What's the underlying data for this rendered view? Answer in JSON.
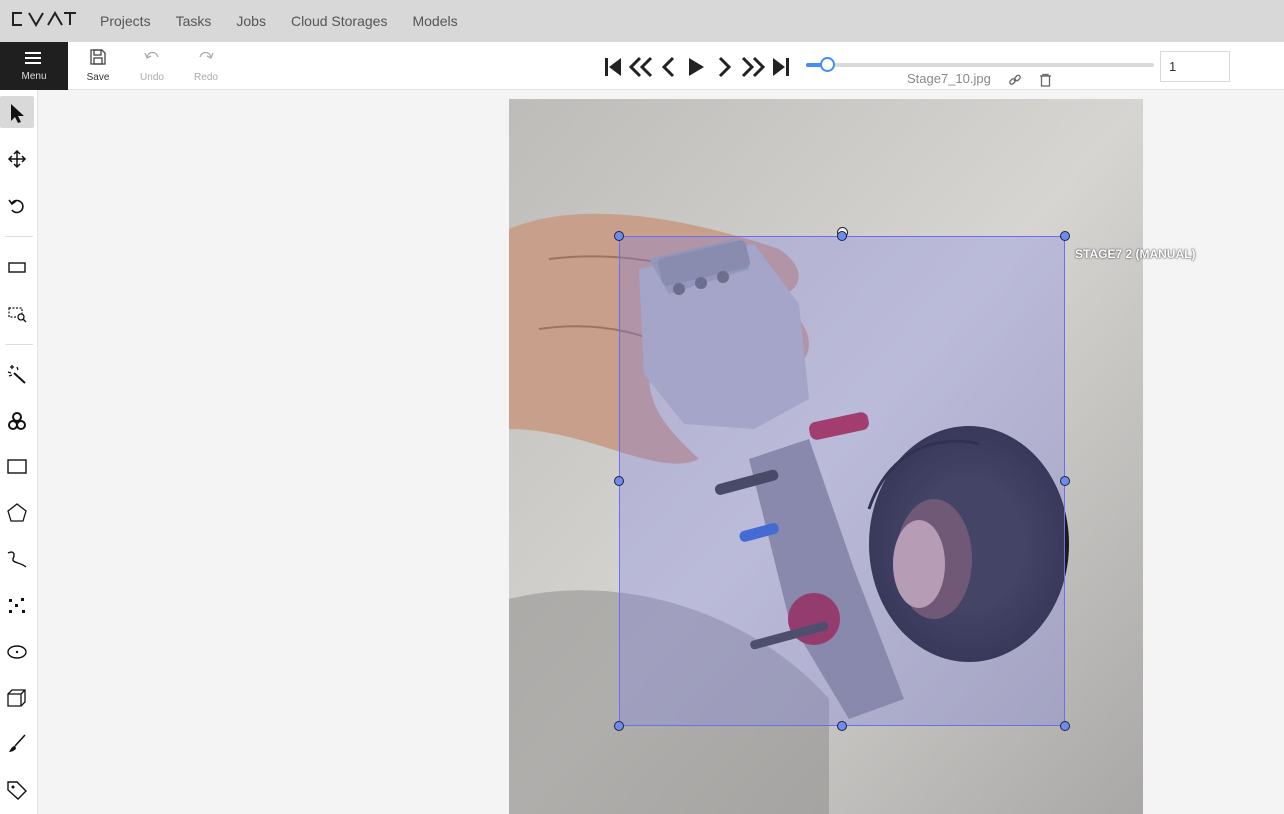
{
  "header": {
    "logo_text": "CVAT",
    "nav": [
      "Projects",
      "Tasks",
      "Jobs",
      "Cloud Storages",
      "Models"
    ]
  },
  "toolbar": {
    "menu_label": "Menu",
    "save_label": "Save",
    "undo_label": "Undo",
    "redo_label": "Redo",
    "filename": "Stage7_10.jpg",
    "frame_number": "1"
  },
  "player": {
    "buttons": [
      "first-frame",
      "previous-step",
      "previous-frame",
      "play",
      "next-frame",
      "next-step",
      "last-frame"
    ],
    "slider_value_fraction": 0.03
  },
  "sidebar": {
    "tools": [
      "cursor-icon",
      "move-icon",
      "rotate-icon",
      "fit-image-icon",
      "zoom-region-icon",
      "magic-wand-icon",
      "openvino-icon",
      "rectangle-icon",
      "polygon-icon",
      "polyline-icon",
      "points-icon",
      "ellipse-icon",
      "cuboid-icon",
      "brush-icon",
      "tag-icon"
    ]
  },
  "annotation": {
    "label": "STAGE7 2 (MANUAL)",
    "color": "#6c6cf5"
  },
  "colors": {
    "accent": "#3f8ef4",
    "header_bg": "#d8d8d8",
    "menu_bg": "#1f1f1f"
  }
}
